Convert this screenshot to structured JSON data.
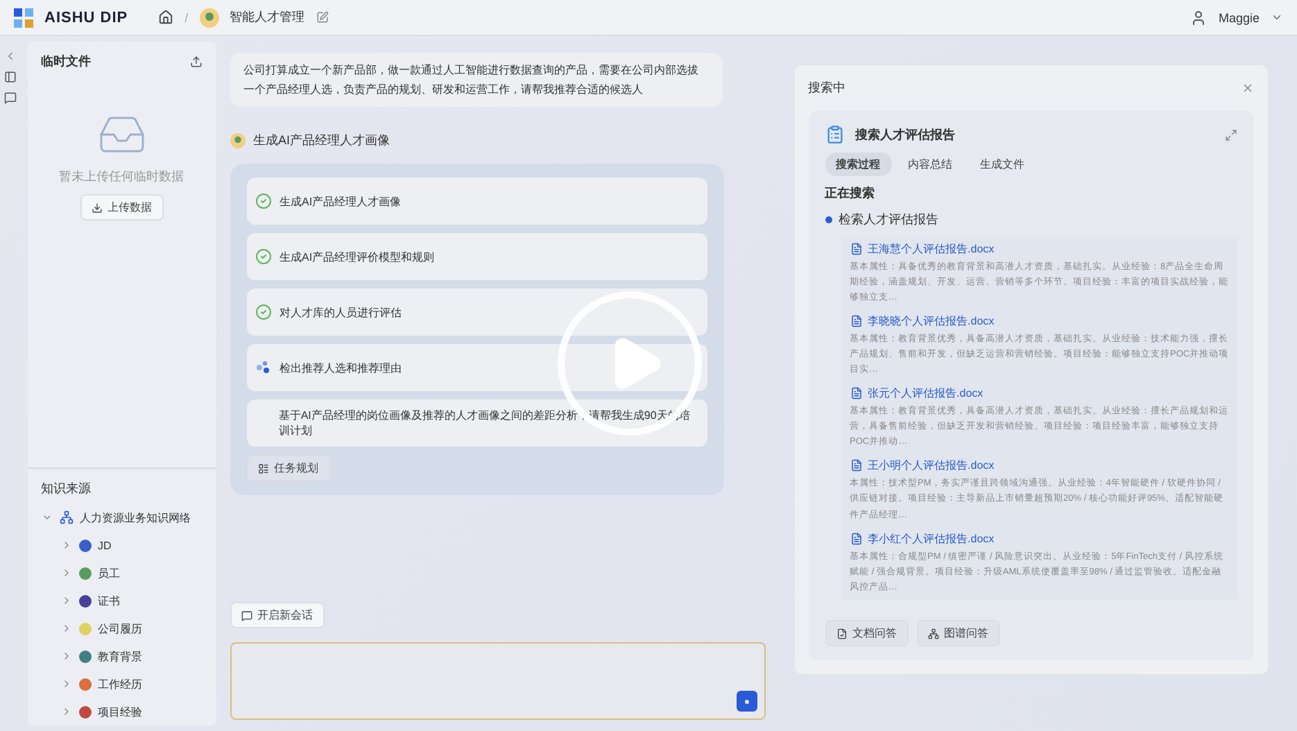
{
  "header": {
    "logo": "AISHU DIP",
    "breadcrumb_separator": "/",
    "app_title": "智能人才管理",
    "user": "Maggie"
  },
  "temp_files": {
    "title": "临时文件",
    "empty_text": "暂未上传任何临时数据",
    "upload_button": "上传数据"
  },
  "knowledge": {
    "title": "知识来源",
    "tree": [
      {
        "label": "人力资源业务知识网络",
        "expanded": true,
        "children": [
          {
            "label": "JD",
            "color": "#3a5fc8",
            "expanded": false
          },
          {
            "label": "员工",
            "color": "#5a9a5e",
            "expanded": false
          },
          {
            "label": "证书",
            "color": "#4a3f9a",
            "expanded": false
          },
          {
            "label": "公司履历",
            "color": "#e0d060",
            "expanded": false
          },
          {
            "label": "教育背景",
            "color": "#3f8080",
            "expanded": false
          },
          {
            "label": "工作经历",
            "color": "#d87040",
            "expanded": false
          },
          {
            "label": "项目经验",
            "color": "#c04a40",
            "expanded": false
          }
        ]
      }
    ]
  },
  "chat": {
    "user_message": "公司打算成立一个新产品部，做一款通过人工智能进行数据查询的产品，需要在公司内部选拔一个产品经理人选，负责产品的规划、研发和运营工作，请帮我推荐合适的候选人",
    "agent_title": "生成AI产品经理人才画像",
    "tasks": [
      {
        "text": "生成AI产品经理人才画像",
        "kind": "done"
      },
      {
        "text": "生成AI产品经理评价模型和规则",
        "kind": "done"
      },
      {
        "text": "对人才库的人员进行评估",
        "kind": "done"
      },
      {
        "text": "检出推荐人选和推荐理由",
        "kind": "running"
      },
      {
        "text": "基于AI产品经理的岗位画像及推荐的人才画像之间的差距分析，请帮我生成90天的培训计划",
        "kind": "pending"
      }
    ],
    "plan_button": "任务规划",
    "new_chat_button": "开启新会话"
  },
  "search_panel": {
    "title": "搜索中",
    "card_title": "搜索人才评估报告",
    "tabs": [
      {
        "label": "搜索过程",
        "selected": true
      },
      {
        "label": "内容总结",
        "selected": false
      },
      {
        "label": "生成文件",
        "selected": false
      }
    ],
    "status": "正在搜索",
    "step": "检索人才评估报告",
    "results": [
      {
        "file": "王海慧个人评估报告.docx",
        "snippet": "基本属性：具备优秀的教育背景和高潜人才资质，基础扎实。从业经验：8产品全生命周期经验，涵盖规划、开发、运营、营销等多个环节。项目经验：丰富的项目实战经验，能够独立支…"
      },
      {
        "file": "李晓晓个人评估报告.docx",
        "snippet": "基本属性：教育背景优秀，具备高潜人才资质，基础扎实。从业经验：技术能力强，擅长产品规划、售前和开发，但缺乏运营和营销经验。项目经验：能够独立支持POC并推动项目实…"
      },
      {
        "file": "张元个人评估报告.docx",
        "snippet": "基本属性：教育背景优秀，具备高潜人才资质，基础扎实。从业经验：擅长产品规划和运营，具备售前经验，但缺乏开发和营销经验。项目经验：项目经验丰富，能够独立支持POC并推动…"
      },
      {
        "file": "王小明个人评估报告.docx",
        "snippet": "本属性：技术型PM，务实严谨且跨领域沟通强。从业经验：4年智能硬件 / 软硬件协同 / 供应链对接。项目经验：主导新品上市销量超预期20% / 核心功能好评95%。适配智能硬件产品经理…"
      },
      {
        "file": "李小红个人评估报告.docx",
        "snippet": "基本属性：合规型PM / 缜密严谨 / 风险意识突出。从业经验：5年FinTech支付 / 风控系统赋能 / 强合规背景。项目经验：升级AML系统使覆盖率至98% / 通过监管验收。适配金融风控产品…"
      }
    ],
    "footer_buttons": [
      {
        "label": "文档问答",
        "kind": "doc"
      },
      {
        "label": "图谱问答",
        "kind": "graph"
      }
    ]
  }
}
